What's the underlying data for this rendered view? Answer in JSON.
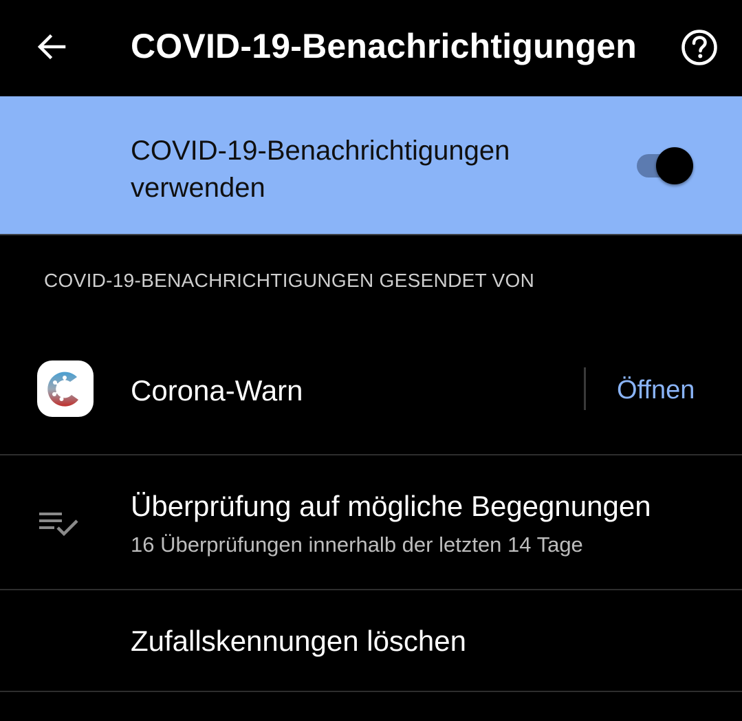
{
  "header": {
    "title": "COVID-19-Benachrichtigungen",
    "back_icon": "arrow-back-icon",
    "help_icon": "help-circle-icon"
  },
  "toggle": {
    "label": "COVID-19-Benachrichtigungen verwenden",
    "checked": true
  },
  "section": {
    "header": "COVID-19-BENACHRICHTIGUNGEN GESENDET VON"
  },
  "app": {
    "name": "Corona-Warn",
    "open_label": "Öffnen",
    "icon": "corona-warn-app-icon"
  },
  "exposure_check": {
    "title": "Überprüfung auf mögliche Begegnungen",
    "subtitle": "16 Überprüfungen innerhalb der letzten 14 Tage",
    "icon": "checklist-icon"
  },
  "delete_ids": {
    "label": "Zufallskennungen löschen"
  },
  "colors": {
    "background": "#000000",
    "banner": "#8ab4f8",
    "accent": "#8ab4f8",
    "switch_track": "#5c7bb0",
    "switch_thumb": "#000000",
    "secondary_text": "#bdbdbd"
  }
}
